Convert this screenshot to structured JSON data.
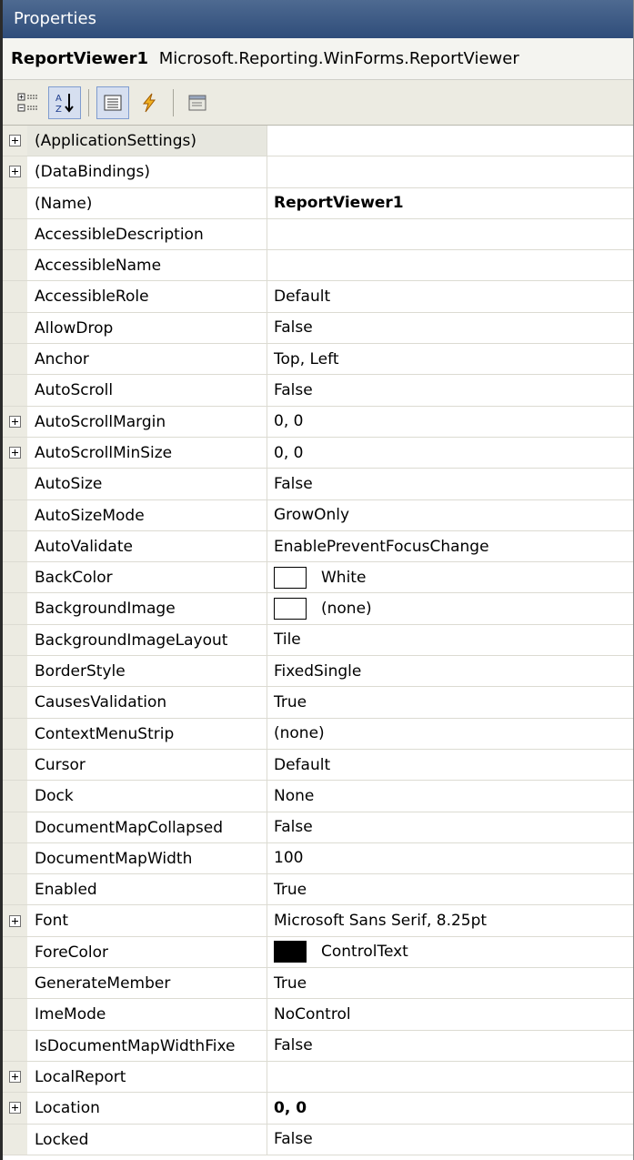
{
  "window": {
    "title": "Properties"
  },
  "object": {
    "name": "ReportViewer1",
    "type": "Microsoft.Reporting.WinForms.ReportViewer"
  },
  "toolbar": {
    "buttons": [
      {
        "name": "categorized-button",
        "icon": "categorized-icon"
      },
      {
        "name": "alphabetical-button",
        "icon": "alphabetical-sort-icon",
        "pressed": true
      },
      {
        "name": "properties-button",
        "icon": "properties-list-icon",
        "pressed": true
      },
      {
        "name": "events-button",
        "icon": "lightning-icon"
      },
      {
        "name": "property-pages-button",
        "icon": "property-pages-icon"
      }
    ]
  },
  "properties": [
    {
      "name": "(ApplicationSettings)",
      "value": "",
      "expandable": true,
      "selected": true
    },
    {
      "name": "(DataBindings)",
      "value": "",
      "expandable": true
    },
    {
      "name": "(Name)",
      "value": "ReportViewer1",
      "bold": true
    },
    {
      "name": "AccessibleDescription",
      "value": ""
    },
    {
      "name": "AccessibleName",
      "value": ""
    },
    {
      "name": "AccessibleRole",
      "value": "Default"
    },
    {
      "name": "AllowDrop",
      "value": "False"
    },
    {
      "name": "Anchor",
      "value": "Top, Left"
    },
    {
      "name": "AutoScroll",
      "value": "False"
    },
    {
      "name": "AutoScrollMargin",
      "value": "0, 0",
      "expandable": true
    },
    {
      "name": "AutoScrollMinSize",
      "value": "0, 0",
      "expandable": true
    },
    {
      "name": "AutoSize",
      "value": "False"
    },
    {
      "name": "AutoSizeMode",
      "value": "GrowOnly"
    },
    {
      "name": "AutoValidate",
      "value": "EnablePreventFocusChange"
    },
    {
      "name": "BackColor",
      "value": "White",
      "swatch": "#ffffff"
    },
    {
      "name": "BackgroundImage",
      "value": "(none)",
      "swatch": "#ffffff"
    },
    {
      "name": "BackgroundImageLayout",
      "value": "Tile"
    },
    {
      "name": "BorderStyle",
      "value": "FixedSingle"
    },
    {
      "name": "CausesValidation",
      "value": "True"
    },
    {
      "name": "ContextMenuStrip",
      "value": "(none)"
    },
    {
      "name": "Cursor",
      "value": "Default"
    },
    {
      "name": "Dock",
      "value": "None"
    },
    {
      "name": "DocumentMapCollapsed",
      "value": "False"
    },
    {
      "name": "DocumentMapWidth",
      "value": "100"
    },
    {
      "name": "Enabled",
      "value": "True"
    },
    {
      "name": "Font",
      "value": "Microsoft Sans Serif, 8.25pt",
      "expandable": true
    },
    {
      "name": "ForeColor",
      "value": "ControlText",
      "swatch": "#000000"
    },
    {
      "name": "GenerateMember",
      "value": "True"
    },
    {
      "name": "ImeMode",
      "value": "NoControl"
    },
    {
      "name": "IsDocumentMapWidthFixe",
      "value": "False"
    },
    {
      "name": "LocalReport",
      "value": "",
      "expandable": true
    },
    {
      "name": "Location",
      "value": "0, 0",
      "expandable": true,
      "bold": true
    },
    {
      "name": "Locked",
      "value": "False"
    }
  ]
}
